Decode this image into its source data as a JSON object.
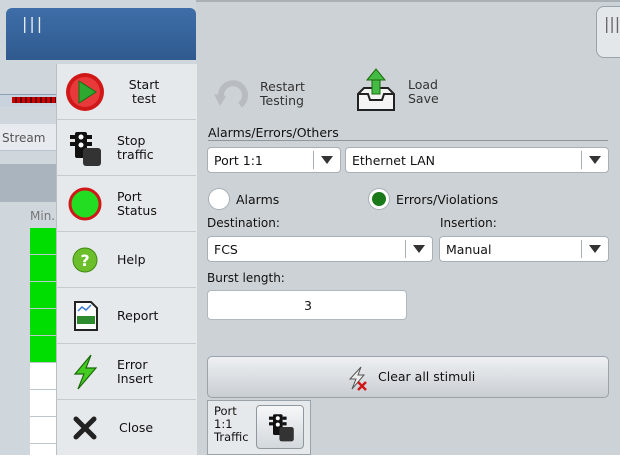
{
  "background_app": {
    "tab_label": "Stream",
    "column_label": "Min."
  },
  "side_menu": {
    "items": [
      {
        "label_line1": "Start",
        "label_line2": "test",
        "icon": "start-play-icon"
      },
      {
        "label_line1": "Stop",
        "label_line2": "traffic",
        "icon": "traffic-light-icon"
      },
      {
        "label_line1": "Port",
        "label_line2": "Status",
        "icon": "port-status-icon"
      },
      {
        "label_line1": "Help",
        "label_line2": "",
        "icon": "help-icon"
      },
      {
        "label_line1": "Report",
        "label_line2": "",
        "icon": "report-icon"
      },
      {
        "label_line1": "Error",
        "label_line2": "Insert",
        "icon": "lightning-icon"
      },
      {
        "label_line1": "Close",
        "label_line2": "",
        "icon": "close-icon"
      }
    ]
  },
  "toolbar": {
    "restart_line1": "Restart",
    "restart_line2": "Testing",
    "load_line1": "Load",
    "load_line2": "Save"
  },
  "alarms_group": {
    "title": "Alarms/Errors/Others",
    "port_select": "Port 1:1",
    "interface_select": "Ethernet LAN",
    "radio_alarms": "Alarms",
    "radio_errors": "Errors/Violations",
    "selected_radio": "Errors/Violations",
    "destination_label": "Destination:",
    "destination_value": "FCS",
    "insertion_label": "Insertion:",
    "insertion_value": "Manual",
    "burst_label": "Burst length:",
    "burst_value": "3"
  },
  "clear_button": {
    "label": "Clear all stimuli"
  },
  "port_traffic": {
    "line1": "Port",
    "line2": "1:1",
    "line3": "Traffic"
  },
  "colors": {
    "play_red": "#d01818",
    "play_green": "#2ea82e",
    "status_green": "#22dd22",
    "selected_radio": "#1a7a1a",
    "background_green": "#00dd00"
  }
}
